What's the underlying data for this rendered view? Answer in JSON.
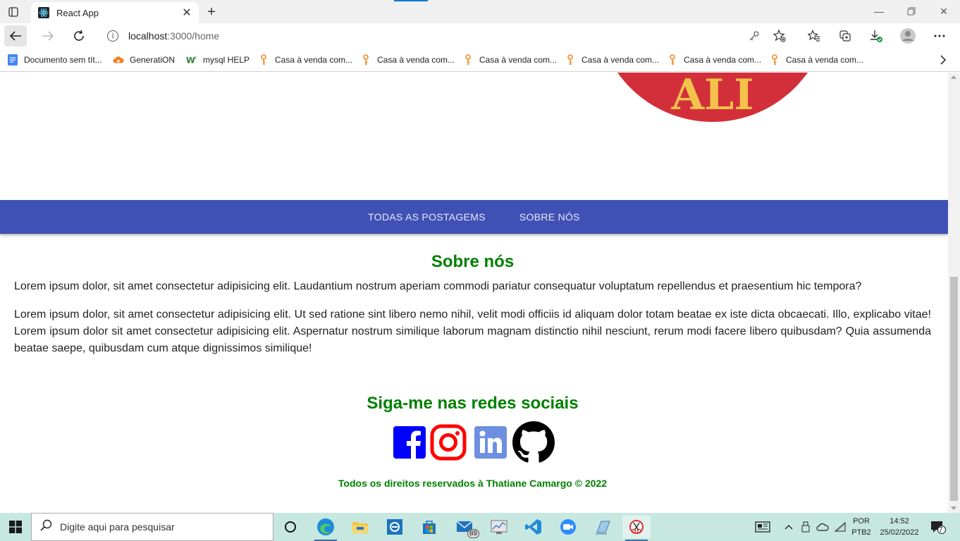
{
  "browser": {
    "tab_title": "React App",
    "url_host": "localhost",
    "url_path": ":3000/home",
    "bookmarks": [
      {
        "label": "Documento sem tít...",
        "icon": "docs-icon"
      },
      {
        "label": "GeneratiON",
        "icon": "cloud-icon"
      },
      {
        "label": "mysql HELP",
        "icon": "w3schools-icon"
      },
      {
        "label": "Casa à venda com...",
        "icon": "key-icon"
      },
      {
        "label": "Casa à venda com...",
        "icon": "key-icon"
      },
      {
        "label": "Casa à venda com...",
        "icon": "key-icon"
      },
      {
        "label": "Casa à venda com...",
        "icon": "key-icon"
      },
      {
        "label": "Casa à venda com...",
        "icon": "key-icon"
      },
      {
        "label": "Casa à venda com...",
        "icon": "key-icon"
      }
    ]
  },
  "page": {
    "nav": {
      "all_posts": "TODAS AS POSTAGEMS",
      "about": "SOBRE NÓS"
    },
    "about_title": "Sobre nós",
    "paragraph1": "Lorem ipsum dolor, sit amet consectetur adipisicing elit. Laudantium nostrum aperiam commodi pariatur consequatur voluptatum repellendus et praesentium hic tempora?",
    "paragraph2": "Lorem ipsum dolor, sit amet consectetur adipisicing elit. Ut sed ratione sint libero nemo nihil, velit modi officiis id aliquam dolor totam beatae ex iste dicta obcaecati. Illo, explicabo vitae! Lorem ipsum dolor sit amet consectetur adipisicing elit. Aspernatur nostrum similique laborum magnam distinctio nihil nesciunt, rerum modi facere libero quibusdam? Quia assumenda beatae saepe, quibusdam cum atque dignissimos similique!",
    "social_title": "Siga-me nas redes sociais",
    "social": [
      "facebook-icon",
      "instagram-icon",
      "linkedin-icon",
      "github-icon"
    ],
    "footer": "Todos os direitos reservados à Thatiane Camargo © 2022",
    "logo_text": "ALI"
  },
  "taskbar": {
    "search_placeholder": "Digite aqui para pesquisar",
    "mail_badge": "89",
    "lang_line1": "POR",
    "lang_line2": "PTB2",
    "time": "14:52",
    "date": "25/02/2022",
    "notifications": "7"
  },
  "colors": {
    "navbar": "#3f51b5",
    "heading_green": "#008000",
    "facebook": "#0000ff",
    "instagram": "#ff0000",
    "linkedin": "#6d8fe0",
    "github": "#000000",
    "taskbar": "#c6e8e0"
  }
}
